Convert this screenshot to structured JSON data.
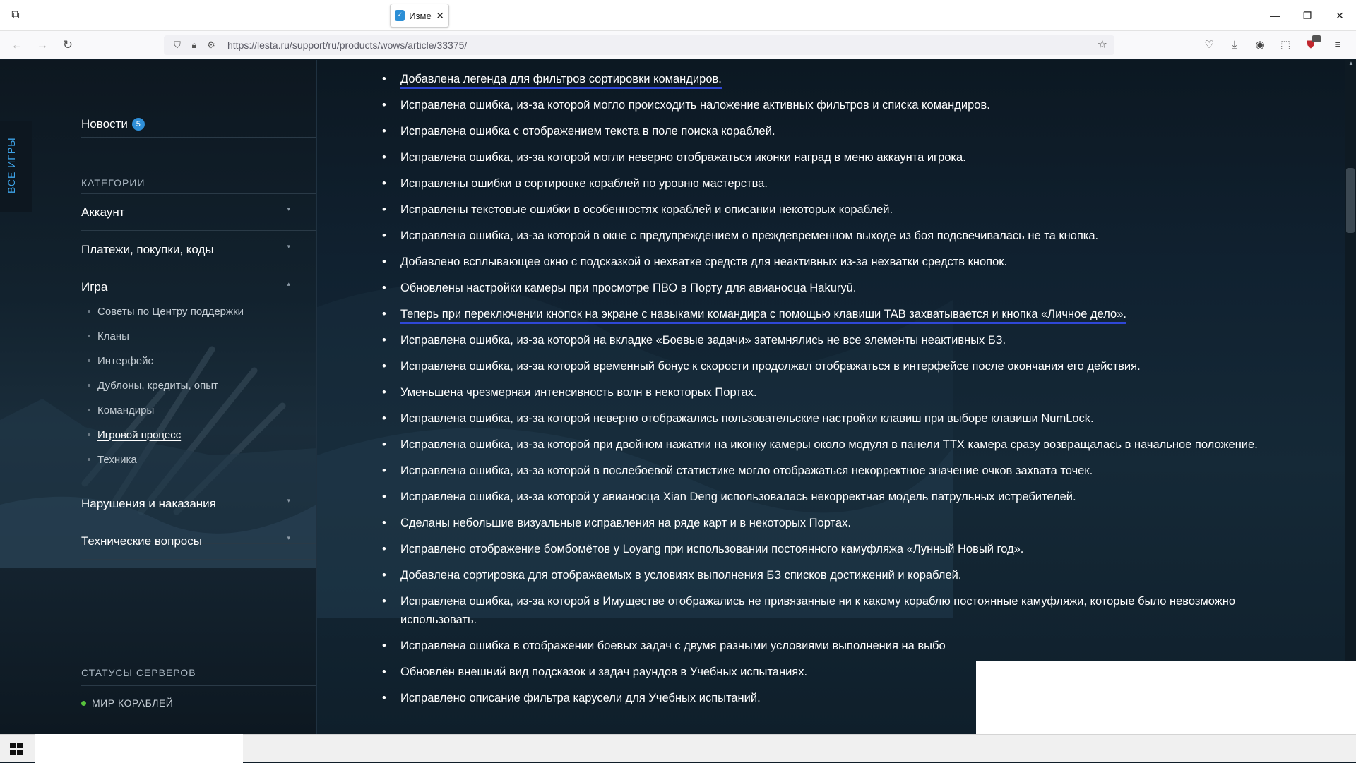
{
  "browser": {
    "tab_title": "Изме",
    "url": "https://lesta.ru/support/ru/products/wows/article/33375/"
  },
  "sidebar": {
    "all_games": "ВСЕ ИГРЫ",
    "news": {
      "label": "Новости",
      "badge": "5"
    },
    "categories_heading": "КАТЕГОРИИ",
    "categories": [
      {
        "label": "Аккаунт"
      },
      {
        "label": "Платежи, покупки, коды"
      },
      {
        "label": "Игра"
      },
      {
        "label": "Нарушения и наказания"
      },
      {
        "label": "Технические вопросы"
      }
    ],
    "game_subitems": [
      "Советы по Центру поддержки",
      "Кланы",
      "Интерфейс",
      "Дублоны, кредиты, опыт",
      "Командиры",
      "Игровой процесс",
      "Техника"
    ],
    "servers_heading": "СТАТУСЫ СЕРВЕРОВ",
    "server": "МИР КОРАБЛЕЙ"
  },
  "content": {
    "notes": [
      "Добавлена легенда для фильтров сортировки командиров.",
      "Исправлена ошибка, из-за которой могло происходить наложение активных фильтров и списка командиров.",
      "Исправлена ошибка с отображением текста в поле поиска кораблей.",
      "Исправлена ошибка, из-за которой могли неверно отображаться иконки наград в меню аккаунта игрока.",
      "Исправлены ошибки в сортировке кораблей по уровню мастерства.",
      "Исправлены текстовые ошибки в особенностях кораблей и описании некоторых кораблей.",
      "Исправлена ошибка, из-за которой в окне с предупреждением о преждевременном выходе из боя подсвечивалась не та кнопка.",
      "Добавлено всплывающее окно с подсказкой о нехватке средств для неактивных из-за нехватки средств кнопок.",
      "Обновлены настройки камеры при просмотре ПВО в Порту для авианосца Hakuryū.",
      "Теперь при переключении кнопок на экране с навыками командира с помощью клавиши TAB захватывается и кнопка «Личное дело».",
      "Исправлена ошибка, из-за которой на вкладке «Боевые задачи» затемнялись не все элементы неактивных БЗ.",
      "Исправлена ошибка, из-за которой временный бонус к скорости продолжал отображаться в интерфейсе после окончания его действия.",
      "Уменьшена чрезмерная интенсивность волн в некоторых Портах.",
      "Исправлена ошибка, из-за которой неверно отображались пользовательские настройки клавиш при выборе клавиши NumLock.",
      "Исправлена ошибка, из-за которой при двойном нажатии на иконку камеры около модуля в панели ТТХ камера сразу возвращалась в начальное положение.",
      "Исправлена ошибка, из-за которой в послебоевой статистике могло отображаться некорректное значение очков захвата точек.",
      "Исправлена ошибка, из-за которой у авианосца Xian Deng использовалась некорректная модель патрульных истребителей.",
      "Сделаны небольшие визуальные исправления на ряде карт и в некоторых Портах.",
      "Исправлено отображение бомбомётов у Loyang при использовании постоянного камуфляжа «Лунный Новый год».",
      "Добавлена сортировка для отображаемых в условиях выполнения БЗ списков достижений и кораблей.",
      "Исправлена ошибка, из-за которой в Имуществе отображались не привязанные ни к какому кораблю постоянные камуфляжи, которые было невозможно использовать.",
      "Исправлена ошибка в отображении боевых задач с двумя разными условиями выполнения на выбо",
      "Обновлён внешний вид подсказок и задач раундов в Учебных испытаниях.",
      "Исправлено описание фильтра карусели для Учебных испытаний."
    ]
  },
  "colors": {
    "accent": "#3da3e8",
    "highlight_underline": "#2f47d6",
    "server_online": "#57c13c"
  }
}
